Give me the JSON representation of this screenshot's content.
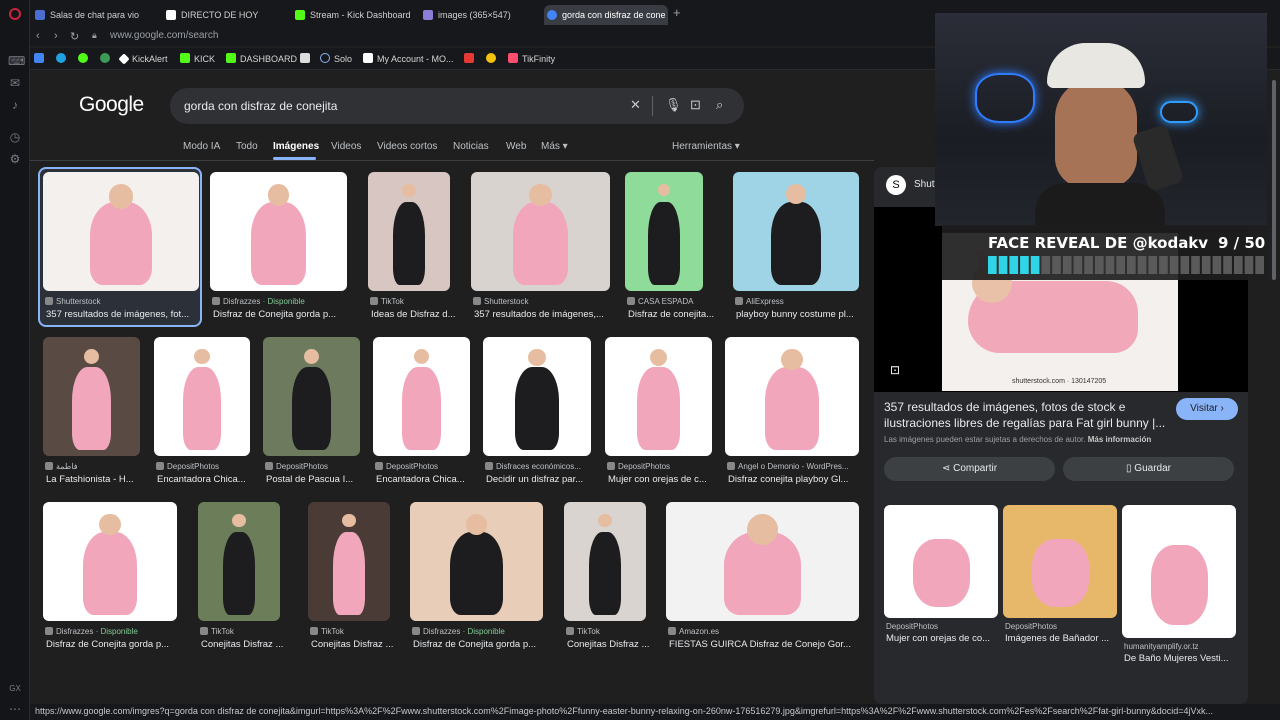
{
  "tabs": [
    {
      "label": "Salas de chat para vio",
      "color": "#4a6fd1"
    },
    {
      "label": "DIRECTO DE HOY",
      "color": "#ffffff"
    },
    {
      "label": "Stream - Kick Dashboard",
      "color": "#53fc18"
    },
    {
      "label": "images (365×547)",
      "color": "#8a7fd8"
    },
    {
      "label": "gorda con disfraz de cone",
      "color": "#4285f4"
    }
  ],
  "address": {
    "url": "www.google.com/search"
  },
  "bookmarks": [
    {
      "label": "",
      "color": "#4285f4"
    },
    {
      "label": "",
      "color": "#1fa2e0"
    },
    {
      "label": "",
      "color": "#53fc18"
    },
    {
      "label": "",
      "color": "#3c9a57"
    },
    {
      "label": "KickAlert",
      "color": "#ffffff"
    },
    {
      "label": "KICK",
      "color": "#53fc18"
    },
    {
      "label": "DASHBOARD",
      "color": "#53fc18"
    },
    {
      "label": "",
      "color": "#dddddd"
    },
    {
      "label": "Solo",
      "color": "#8ab4f8"
    },
    {
      "label": "My Account - MO...",
      "color": "#ffffff"
    },
    {
      "label": "",
      "color": "#e53935"
    },
    {
      "label": "",
      "color": "#f4c20d"
    },
    {
      "label": "TikFinity",
      "color": "#ff4d6d"
    }
  ],
  "google": {
    "logo": "Google",
    "query": "gorda con disfraz de conejita",
    "nav": [
      "Modo IA",
      "Todo",
      "Imágenes",
      "Videos",
      "Videos cortos",
      "Noticias",
      "Web",
      "Más ▾"
    ],
    "tools": "Herramientas ▾"
  },
  "results": [
    {
      "source": "Shutterstock",
      "title": "357 resultados de imágenes, fot...",
      "bg": "#f4f0ee",
      "avail": ""
    },
    {
      "source": "Disfrazzes",
      "avail": "Disponible",
      "title": "Disfraz de Conejita gorda p...",
      "bg": "#ffffff"
    },
    {
      "source": "TikTok",
      "avail": "",
      "title": "Ideas de Disfraz d...",
      "bg": "#d8c6c2"
    },
    {
      "source": "Shutterstock",
      "avail": "",
      "title": "357 resultados de imágenes,...",
      "bg": "#d9d3cf"
    },
    {
      "source": "CASA ESPADA",
      "avail": "",
      "title": "Disfraz de conejita...",
      "bg": "#8fdc9a"
    },
    {
      "source": "AliExpress",
      "avail": "",
      "title": "playboy bunny costume pl...",
      "bg": "#9fd3e6"
    },
    {
      "source": "فاطمة",
      "avail": "",
      "title": "La Fatshionista - H...",
      "bg": "#5a4a44"
    },
    {
      "source": "DepositPhotos",
      "avail": "",
      "title": "Encantadora Chica...",
      "bg": "#ffffff"
    },
    {
      "source": "DepositPhotos",
      "avail": "",
      "title": "Postal de Pascua I...",
      "bg": "#6e7a5e"
    },
    {
      "source": "DepositPhotos",
      "avail": "",
      "title": "Encantadora Chica...",
      "bg": "#ffffff"
    },
    {
      "source": "Disfraces económicos...",
      "avail": "",
      "title": "Decidir un disfraz par...",
      "bg": "#ffffff"
    },
    {
      "source": "DepositPhotos",
      "avail": "",
      "title": "Mujer con orejas de c...",
      "bg": "#ffffff"
    },
    {
      "source": "Angel o Demonio - WordPres...",
      "avail": "",
      "title": "Disfraz conejita playboy Gl...",
      "bg": "#ffffff"
    },
    {
      "source": "Disfrazzes",
      "avail": "Disponible",
      "title": "Disfraz de Conejita gorda p...",
      "bg": "#ffffff"
    },
    {
      "source": "TikTok",
      "avail": "",
      "title": "Conejitas Disfraz ...",
      "bg": "#6c7d59"
    },
    {
      "source": "TikTok",
      "avail": "",
      "title": "Conejitas Disfraz ...",
      "bg": "#4a3b36"
    },
    {
      "source": "Disfrazzes",
      "avail": "Disponible",
      "title": "Disfraz de Conejita gorda p...",
      "bg": "#e8cdb8"
    },
    {
      "source": "TikTok",
      "avail": "",
      "title": "Conejitas Disfraz ...",
      "bg": "#d9d4d0"
    },
    {
      "source": "Amazon.es",
      "avail": "",
      "title": "FIESTAS GUIRCA Disfraz de Conejo Gor...",
      "bg": "#f2f2f2"
    }
  ],
  "preview": {
    "source": "Shutterstock",
    "image_caption": "shutterstock.com · 130147205",
    "title": "357 resultados de imágenes, fotos de stock e ilustraciones libres de regalías para Fat girl bunny |...",
    "rights": "Las imágenes pueden estar sujetas a derechos de autor.",
    "more_info": "Más información",
    "visit": "Visitar ›",
    "share": "Compartir",
    "save": "Guardar"
  },
  "related": [
    {
      "source": "DepositPhotos",
      "title": "Mujer con orejas de co...",
      "bg": "#ffffff"
    },
    {
      "source": "DepositPhotos",
      "title": "Imágenes de Bañador ...",
      "bg": "#e8b86a"
    },
    {
      "source": "humanityamplify.or.tz",
      "title": "De Baño Mujeres Vesti...",
      "bg": "#ffffff"
    }
  ],
  "overlay": {
    "title": "FACE REVEAL DE @kodakv",
    "count": "9 / 50",
    "progress": 0.18,
    "accent": "#2fd4e6"
  },
  "status": "https://www.google.com/imgres?q=gorda con disfraz de conejita&imgurl=https%3A%2F%2Fwww.shutterstock.com%2Fimage-photo%2Ffunny-easter-bunny-relaxing-on-260nw-176516279.jpg&imgrefurl=https%3A%2F%2Fwww.shutterstock.com%2Fes%2Fsearch%2Ffat-girl-bunny&docid=4jVxk..."
}
